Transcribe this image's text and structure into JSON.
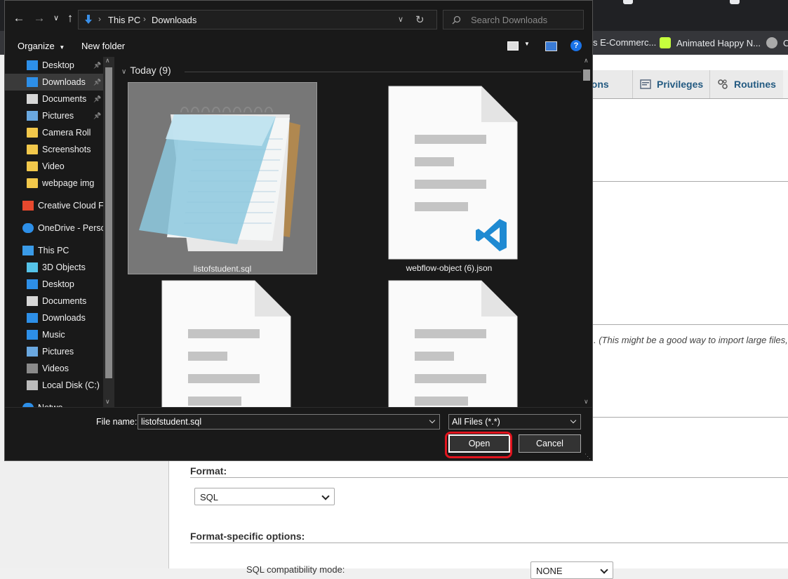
{
  "browser": {
    "bookmarks": [
      {
        "label": "s E-Commerc...",
        "icon": "bookmark-icon",
        "color": "#35363a"
      },
      {
        "label": "Animated Happy N...",
        "icon": "animated-app-icon",
        "color": "#22c55e"
      },
      {
        "label": "O",
        "icon": "globe-icon",
        "color": "#aaaaaa"
      }
    ]
  },
  "pma": {
    "tabs": [
      {
        "label": "rations",
        "icon": "operations-icon"
      },
      {
        "label": "Privileges",
        "icon": "privileges-icon"
      },
      {
        "label": "Routines",
        "icon": "routines-icon"
      }
    ],
    "import_note": ". (This might be a good way to import large files,",
    "format_label": "Format:",
    "format_value": "SQL",
    "format_options_label": "Format-specific options:",
    "compat_label": "SQL compatibility mode:",
    "compat_value": "NONE"
  },
  "dialog": {
    "path": [
      "This PC",
      "Downloads"
    ],
    "search_placeholder": "Search Downloads",
    "organize_label": "Organize",
    "new_folder_label": "New folder",
    "help_label": "?",
    "group_label": "Today (9)",
    "sidebar": [
      {
        "label": "Desktop",
        "icon": "desktop-icon",
        "pinned": true,
        "indent": 1
      },
      {
        "label": "Downloads",
        "icon": "downloads-icon",
        "pinned": true,
        "indent": 1,
        "selected": true
      },
      {
        "label": "Documents",
        "icon": "documents-icon",
        "pinned": true,
        "indent": 1
      },
      {
        "label": "Pictures",
        "icon": "pictures-icon",
        "pinned": true,
        "indent": 1
      },
      {
        "label": "Camera Roll",
        "icon": "folder-icon",
        "pinned": false,
        "indent": 1
      },
      {
        "label": "Screenshots",
        "icon": "folder-icon",
        "pinned": false,
        "indent": 1
      },
      {
        "label": "Video",
        "icon": "folder-icon",
        "pinned": false,
        "indent": 1
      },
      {
        "label": "webpage img",
        "icon": "folder-icon",
        "pinned": false,
        "indent": 1
      },
      {
        "label": "Creative Cloud Fil",
        "icon": "creative-cloud-icon",
        "pinned": false,
        "indent": 0
      },
      {
        "label": "OneDrive - Person",
        "icon": "onedrive-icon",
        "pinned": false,
        "indent": 0
      },
      {
        "label": "This PC",
        "icon": "this-pc-icon",
        "pinned": false,
        "indent": 0
      },
      {
        "label": "3D Objects",
        "icon": "3d-objects-icon",
        "pinned": false,
        "indent": 1
      },
      {
        "label": "Desktop",
        "icon": "desktop-icon",
        "pinned": false,
        "indent": 1
      },
      {
        "label": "Documents",
        "icon": "documents-icon",
        "pinned": false,
        "indent": 1
      },
      {
        "label": "Downloads",
        "icon": "downloads-icon",
        "pinned": false,
        "indent": 1
      },
      {
        "label": "Music",
        "icon": "music-icon",
        "pinned": false,
        "indent": 1
      },
      {
        "label": "Pictures",
        "icon": "pictures-icon",
        "pinned": false,
        "indent": 1
      },
      {
        "label": "Videos",
        "icon": "videos-icon",
        "pinned": false,
        "indent": 1
      },
      {
        "label": "Local Disk (C:)",
        "icon": "local-disk-icon",
        "pinned": false,
        "indent": 1
      },
      {
        "label": "Netwo",
        "icon": "network-icon",
        "pinned": false,
        "indent": 0
      }
    ],
    "files": [
      {
        "name": "listofstudent.sql",
        "icon": "notepad-icon",
        "selected": true
      },
      {
        "name": "webflow-object (6).json",
        "icon": "vscode-file-icon",
        "selected": false
      },
      {
        "name": "",
        "icon": "generic-file-icon",
        "selected": false
      },
      {
        "name": "",
        "icon": "generic-file-icon",
        "selected": false
      }
    ],
    "file_name_label": "File name:",
    "file_name_value": "listofstudent.sql",
    "filter_value": "All Files (*.*)",
    "open_label": "Open",
    "cancel_label": "Cancel"
  }
}
